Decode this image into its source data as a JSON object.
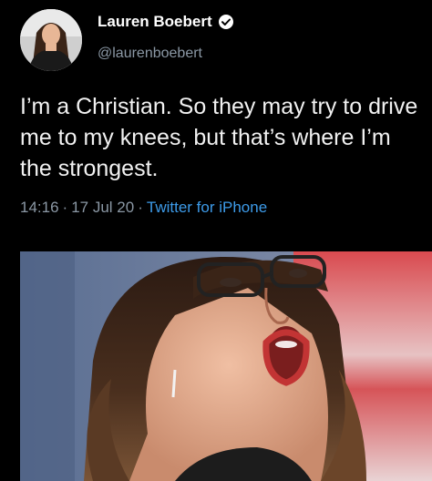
{
  "author": {
    "display_name": "Lauren Boebert",
    "handle": "@laurenboebert",
    "avatar_icon": "profile-avatar",
    "verified_icon": "verified-badge-icon"
  },
  "tweet": {
    "text": "I’m a Christian. So they may try to drive me to my knees, but that’s where I’m the strongest.",
    "time": "14:16",
    "date": "17 Jul 20",
    "separator": "·",
    "source": "Twitter for iPhone"
  },
  "colors": {
    "background": "#000000",
    "secondary_text": "#8b98a5",
    "link": "#3d9be9"
  },
  "media": {
    "icon": "attached-photo"
  }
}
